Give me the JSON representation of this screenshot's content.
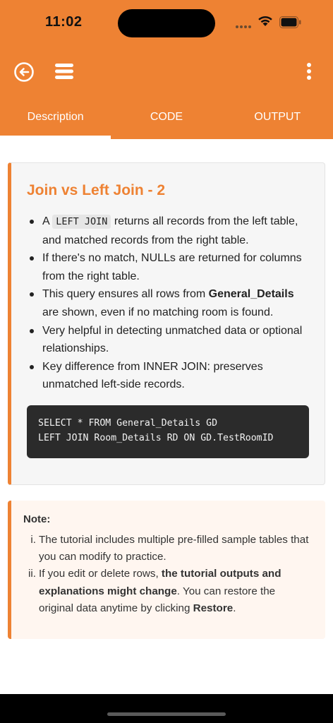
{
  "status": {
    "time": "11:02"
  },
  "tabs": [
    {
      "label": "Description",
      "active": true
    },
    {
      "label": "CODE",
      "active": false
    },
    {
      "label": "OUTPUT",
      "active": false
    }
  ],
  "lesson": {
    "title": "Join vs Left Join - 2",
    "bullets": {
      "b1_pre": "A ",
      "b1_code": "LEFT JOIN",
      "b1_post": " returns all records from the left table, and matched records from the right table.",
      "b2": "If there's no match, NULLs are returned for columns from the right table.",
      "b3_pre": "This query ensures all rows from ",
      "b3_bold": "General_Details",
      "b3_post": " are shown, even if no matching room is found.",
      "b4": "Very helpful in detecting unmatched data or optional relationships.",
      "b5": "Key difference from INNER JOIN: preserves unmatched left-side records."
    },
    "code": [
      "SELECT * FROM General_Details GD",
      "LEFT JOIN Room_Details RD ON GD.TestRoomID"
    ]
  },
  "note": {
    "title": "Note:",
    "items": {
      "i1_num": "i.",
      "i1": "The tutorial includes multiple pre-filled sample tables that you can modify to practice.",
      "i2_num": "ii.",
      "i2_pre": "If you edit or delete rows, ",
      "i2_bold": "the tutorial outputs and explanations might change",
      "i2_mid": ". You can restore the original data anytime by clicking ",
      "i2_bold2": "Restore",
      "i2_post": "."
    }
  },
  "colors": {
    "accent": "#EE8233",
    "code_bg": "#2B2B2B",
    "note_bg": "#FFF6F0"
  },
  "icons": {
    "back": "back-circle-icon",
    "menu": "hamburger-menu-icon",
    "more": "more-vertical-icon"
  }
}
